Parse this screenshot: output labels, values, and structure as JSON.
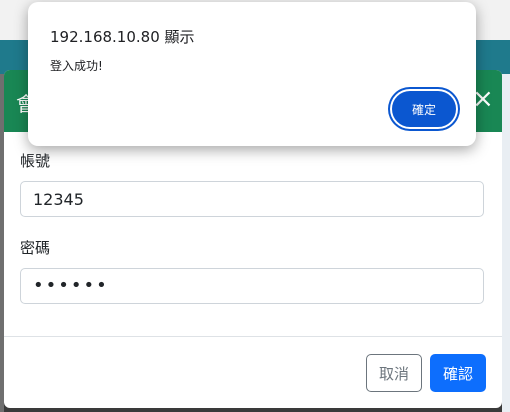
{
  "alert": {
    "origin": "192.168.10.80 顯示",
    "message": "登入成功!",
    "ok_label": "確定"
  },
  "modal": {
    "title": "會",
    "close_glyph": "×",
    "account": {
      "label": "帳號",
      "value": "12345"
    },
    "password": {
      "label": "密碼",
      "value": "••••••"
    },
    "cancel_label": "取消",
    "confirm_label": "確認"
  },
  "colors": {
    "header": "#198754",
    "confirm": "#0d6efd",
    "alert_button": "#0b57d0"
  }
}
